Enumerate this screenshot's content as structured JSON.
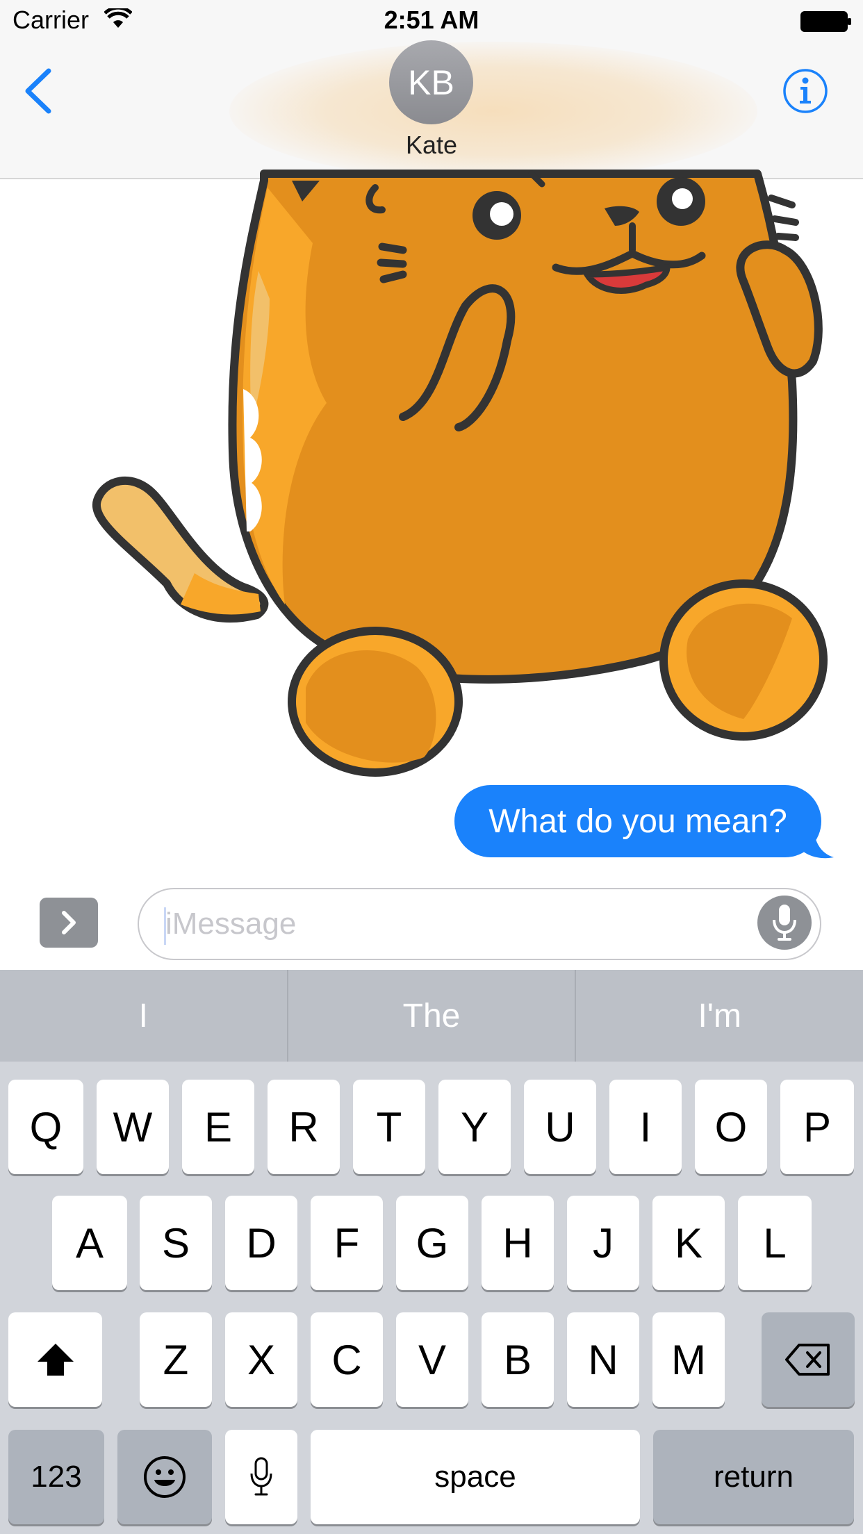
{
  "status_bar": {
    "carrier": "Carrier",
    "time": "2:51 AM"
  },
  "header": {
    "avatar_initials": "KB",
    "contact_name": "Kate"
  },
  "conversation": {
    "sticker": "orange-cat-sticker",
    "messages": [
      {
        "text": "What do you mean?",
        "direction": "outgoing",
        "color": "#1a82fb"
      }
    ]
  },
  "input": {
    "placeholder": "iMessage"
  },
  "keyboard": {
    "predictions": [
      "I",
      "The",
      "I'm"
    ],
    "row1": [
      "Q",
      "W",
      "E",
      "R",
      "T",
      "Y",
      "U",
      "I",
      "O",
      "P"
    ],
    "row2": [
      "A",
      "S",
      "D",
      "F",
      "G",
      "H",
      "J",
      "K",
      "L"
    ],
    "row3": [
      "Z",
      "X",
      "C",
      "V",
      "B",
      "N",
      "M"
    ],
    "numbers_label": "123",
    "space_label": "space",
    "return_label": "return"
  },
  "colors": {
    "accent": "#1a82fb",
    "keyboard_bg": "#d1d4da",
    "cat_orange": "#e38f1d"
  }
}
